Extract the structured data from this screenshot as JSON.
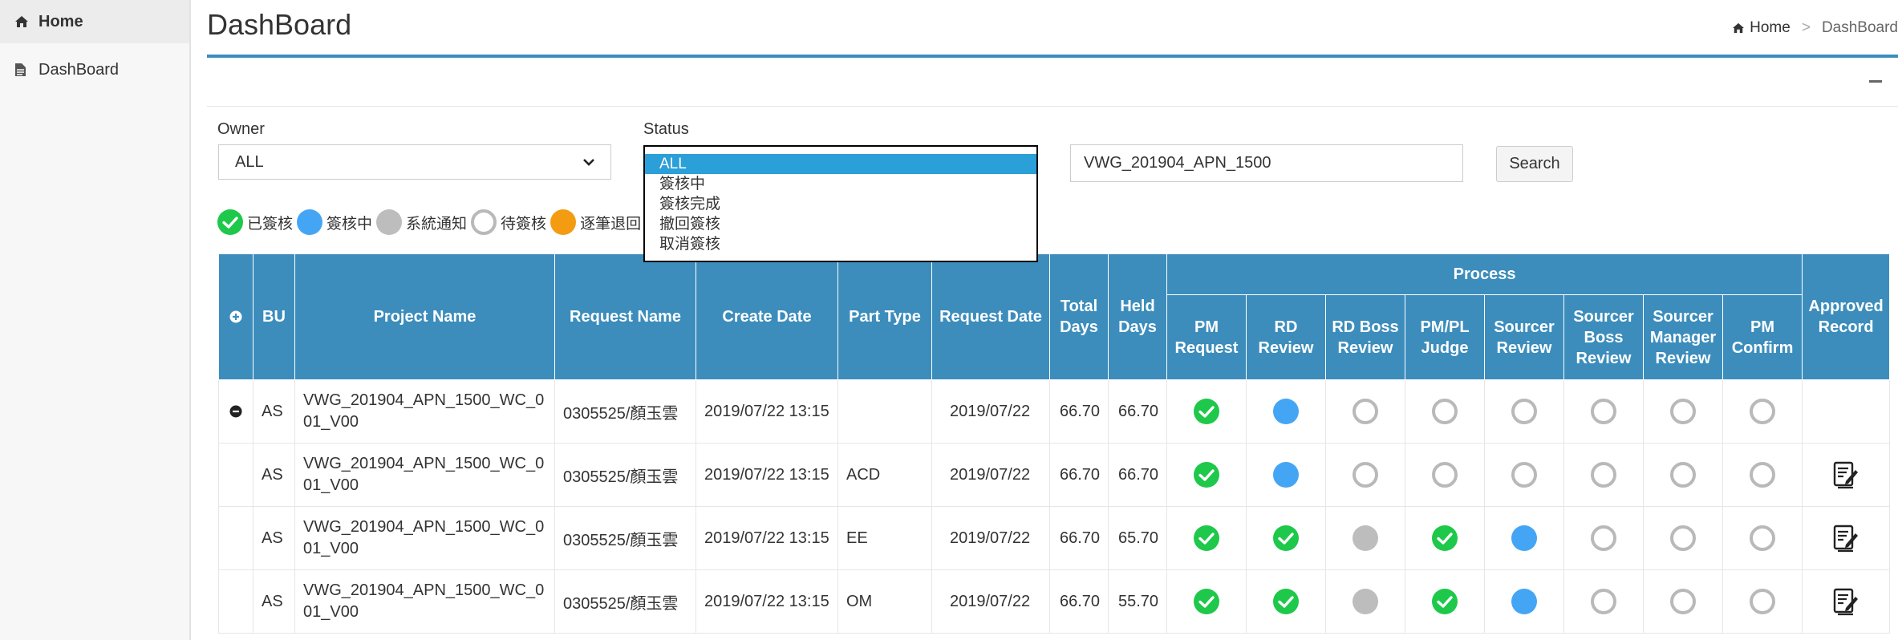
{
  "sidebar": {
    "items": [
      {
        "label": "Home",
        "icon": "home-icon"
      },
      {
        "label": "DashBoard",
        "icon": "file-icon"
      }
    ]
  },
  "header": {
    "title": "DashBoard",
    "breadcrumb": {
      "home": "Home",
      "separator": ">",
      "current": "DashBoard"
    }
  },
  "filters": {
    "owner": {
      "label": "Owner",
      "value": "ALL"
    },
    "status": {
      "label": "Status",
      "options": [
        "ALL",
        "簽核中",
        "簽核完成",
        "撤回簽核",
        "取消簽核"
      ],
      "selected": "ALL"
    },
    "search": {
      "value": "VWG_201904_APN_1500",
      "button": "Search"
    }
  },
  "legend": [
    {
      "label": "已簽核",
      "status": "approved"
    },
    {
      "label": "簽核中",
      "status": "in-progress"
    },
    {
      "label": "系統通知",
      "status": "system"
    },
    {
      "label": "待簽核",
      "status": "pending"
    },
    {
      "label": "逐筆退回",
      "status": "returned"
    }
  ],
  "colors": {
    "approved": "#1ec84a",
    "in_progress": "#45a5f5",
    "system": "#bdbdbd",
    "pending": "#b9b9b9",
    "returned": "#f39c12",
    "header_bg": "#3c8dbc",
    "dropdown_selected": "#2a9fd8"
  },
  "table": {
    "process_group": "Process",
    "columns": {
      "bu": "BU",
      "project": "Project Name",
      "request_name": "Request Name",
      "create_date": "Create Date",
      "part_type": "Part Type",
      "request_date": "Request Date",
      "total_days": "Total Days",
      "held_days": "Held Days",
      "approved_record": "Approved Record"
    },
    "process_columns": [
      "PM Request",
      "RD Review",
      "RD Boss Review",
      "PM/PL Judge",
      "Sourcer Review",
      "Sourcer Boss Review",
      "Sourcer Manager Review",
      "PM Confirm"
    ],
    "rows": [
      {
        "bu": "AS",
        "project": "VWG_201904_APN_1500_WC_001_V00",
        "request_name": "0305525/顏玉雲",
        "create_date": "2019/07/22 13:15",
        "part_type": "",
        "request_date": "2019/07/22",
        "total_days": "66.70",
        "held_days": "66.70",
        "expanded": true,
        "has_record": false,
        "process": [
          "approved",
          "in-progress",
          "pending",
          "pending",
          "pending",
          "pending",
          "pending",
          "pending"
        ]
      },
      {
        "bu": "AS",
        "project": "VWG_201904_APN_1500_WC_001_V00",
        "request_name": "0305525/顏玉雲",
        "create_date": "2019/07/22 13:15",
        "part_type": "ACD",
        "request_date": "2019/07/22",
        "total_days": "66.70",
        "held_days": "66.70",
        "expanded": false,
        "has_record": true,
        "process": [
          "approved",
          "in-progress",
          "pending",
          "pending",
          "pending",
          "pending",
          "pending",
          "pending"
        ]
      },
      {
        "bu": "AS",
        "project": "VWG_201904_APN_1500_WC_001_V00",
        "request_name": "0305525/顏玉雲",
        "create_date": "2019/07/22 13:15",
        "part_type": "EE",
        "request_date": "2019/07/22",
        "total_days": "66.70",
        "held_days": "65.70",
        "expanded": false,
        "has_record": true,
        "process": [
          "approved",
          "approved",
          "system",
          "approved",
          "in-progress",
          "pending",
          "pending",
          "pending"
        ]
      },
      {
        "bu": "AS",
        "project": "VWG_201904_APN_1500_WC_001_V00",
        "request_name": "0305525/顏玉雲",
        "create_date": "2019/07/22 13:15",
        "part_type": "OM",
        "request_date": "2019/07/22",
        "total_days": "66.70",
        "held_days": "55.70",
        "expanded": false,
        "has_record": true,
        "process": [
          "approved",
          "approved",
          "system",
          "approved",
          "in-progress",
          "pending",
          "pending",
          "pending"
        ]
      }
    ]
  }
}
